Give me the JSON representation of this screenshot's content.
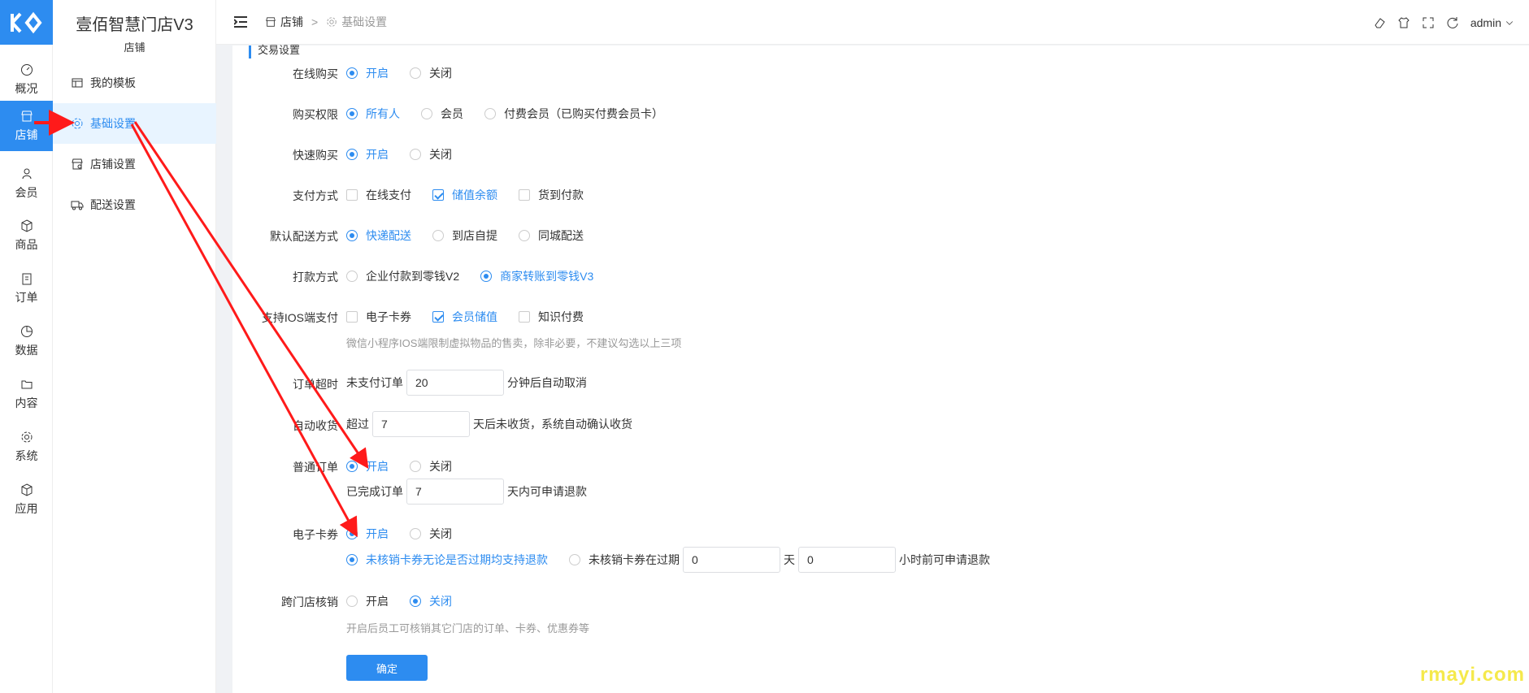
{
  "app": {
    "title": "壹佰智慧门店V3",
    "subtitle": "店铺"
  },
  "rail": [
    {
      "label": "概况",
      "icon": "dashboard-icon"
    },
    {
      "label": "店铺",
      "icon": "store-icon",
      "active": true
    },
    {
      "label": "会员",
      "icon": "user-icon"
    },
    {
      "label": "商品",
      "icon": "cube-icon"
    },
    {
      "label": "订单",
      "icon": "clipboard-icon"
    },
    {
      "label": "数据",
      "icon": "pie-chart-icon"
    },
    {
      "label": "内容",
      "icon": "folder-icon"
    },
    {
      "label": "系统",
      "icon": "gear-icon"
    },
    {
      "label": "应用",
      "icon": "app-box-icon"
    }
  ],
  "sidebar": {
    "items": [
      {
        "label": "我的模板",
        "icon": "template-icon"
      },
      {
        "label": "基础设置",
        "icon": "gear-icon",
        "active": true
      },
      {
        "label": "店铺设置",
        "icon": "store-settings-icon"
      },
      {
        "label": "配送设置",
        "icon": "truck-icon"
      }
    ]
  },
  "topbar": {
    "breadcrumb": [
      "店铺",
      "基础设置"
    ],
    "user": "admin"
  },
  "section": {
    "title": "交易设置"
  },
  "form": {
    "online_buy": {
      "label": "在线购买",
      "options": [
        "开启",
        "关闭"
      ],
      "selected": 0
    },
    "buy_permission": {
      "label": "购买权限",
      "options": [
        "所有人",
        "会员",
        "付费会员（已购买付费会员卡）"
      ],
      "selected": 0
    },
    "quick_buy": {
      "label": "快速购买",
      "options": [
        "开启",
        "关闭"
      ],
      "selected": 0
    },
    "payment": {
      "label": "支付方式",
      "options": [
        "在线支付",
        "储值余额",
        "货到付款"
      ],
      "checked": [
        false,
        true,
        false
      ]
    },
    "delivery": {
      "label": "默认配送方式",
      "options": [
        "快递配送",
        "到店自提",
        "同城配送"
      ],
      "selected": 0
    },
    "payout": {
      "label": "打款方式",
      "options": [
        "企业付款到零钱V2",
        "商家转账到零钱V3"
      ],
      "selected": 1
    },
    "ios_pay": {
      "label": "支持IOS端支付",
      "options": [
        "电子卡券",
        "会员储值",
        "知识付费"
      ],
      "checked": [
        false,
        true,
        false
      ],
      "hint": "微信小程序IOS端限制虚拟物品的售卖，除非必要，不建议勾选以上三项"
    },
    "order_timeout": {
      "label": "订单超时",
      "prefix": "未支付订单",
      "value": "20",
      "suffix": "分钟后自动取消"
    },
    "auto_receive": {
      "label": "自动收货",
      "prefix": "超过",
      "value": "7",
      "suffix": "天后未收货，系统自动确认收货"
    },
    "normal_order": {
      "label": "普通订单",
      "options": [
        "开启",
        "关闭"
      ],
      "selected": 0,
      "prefix": "已完成订单",
      "value": "7",
      "suffix": "天内可申请退款"
    },
    "ecard": {
      "label": "电子卡券",
      "options": [
        "开启",
        "关闭"
      ],
      "selected": 0,
      "refund_opt1": "未核销卡券无论是否过期均支持退款",
      "refund_opt2": "未核销卡券在过期",
      "days": "0",
      "days_unit": "天",
      "hours": "0",
      "hours_suffix": "小时前可申请退款"
    },
    "cross_store": {
      "label": "跨门店核销",
      "options": [
        "开启",
        "关闭"
      ],
      "selected": 1,
      "hint": "开启后员工可核销其它门店的订单、卡券、优惠券等"
    },
    "submit": "确定"
  },
  "watermark": "rmayi.com",
  "colors": {
    "primary": "#2d8cf0",
    "annotation": "#ff1a1a"
  }
}
